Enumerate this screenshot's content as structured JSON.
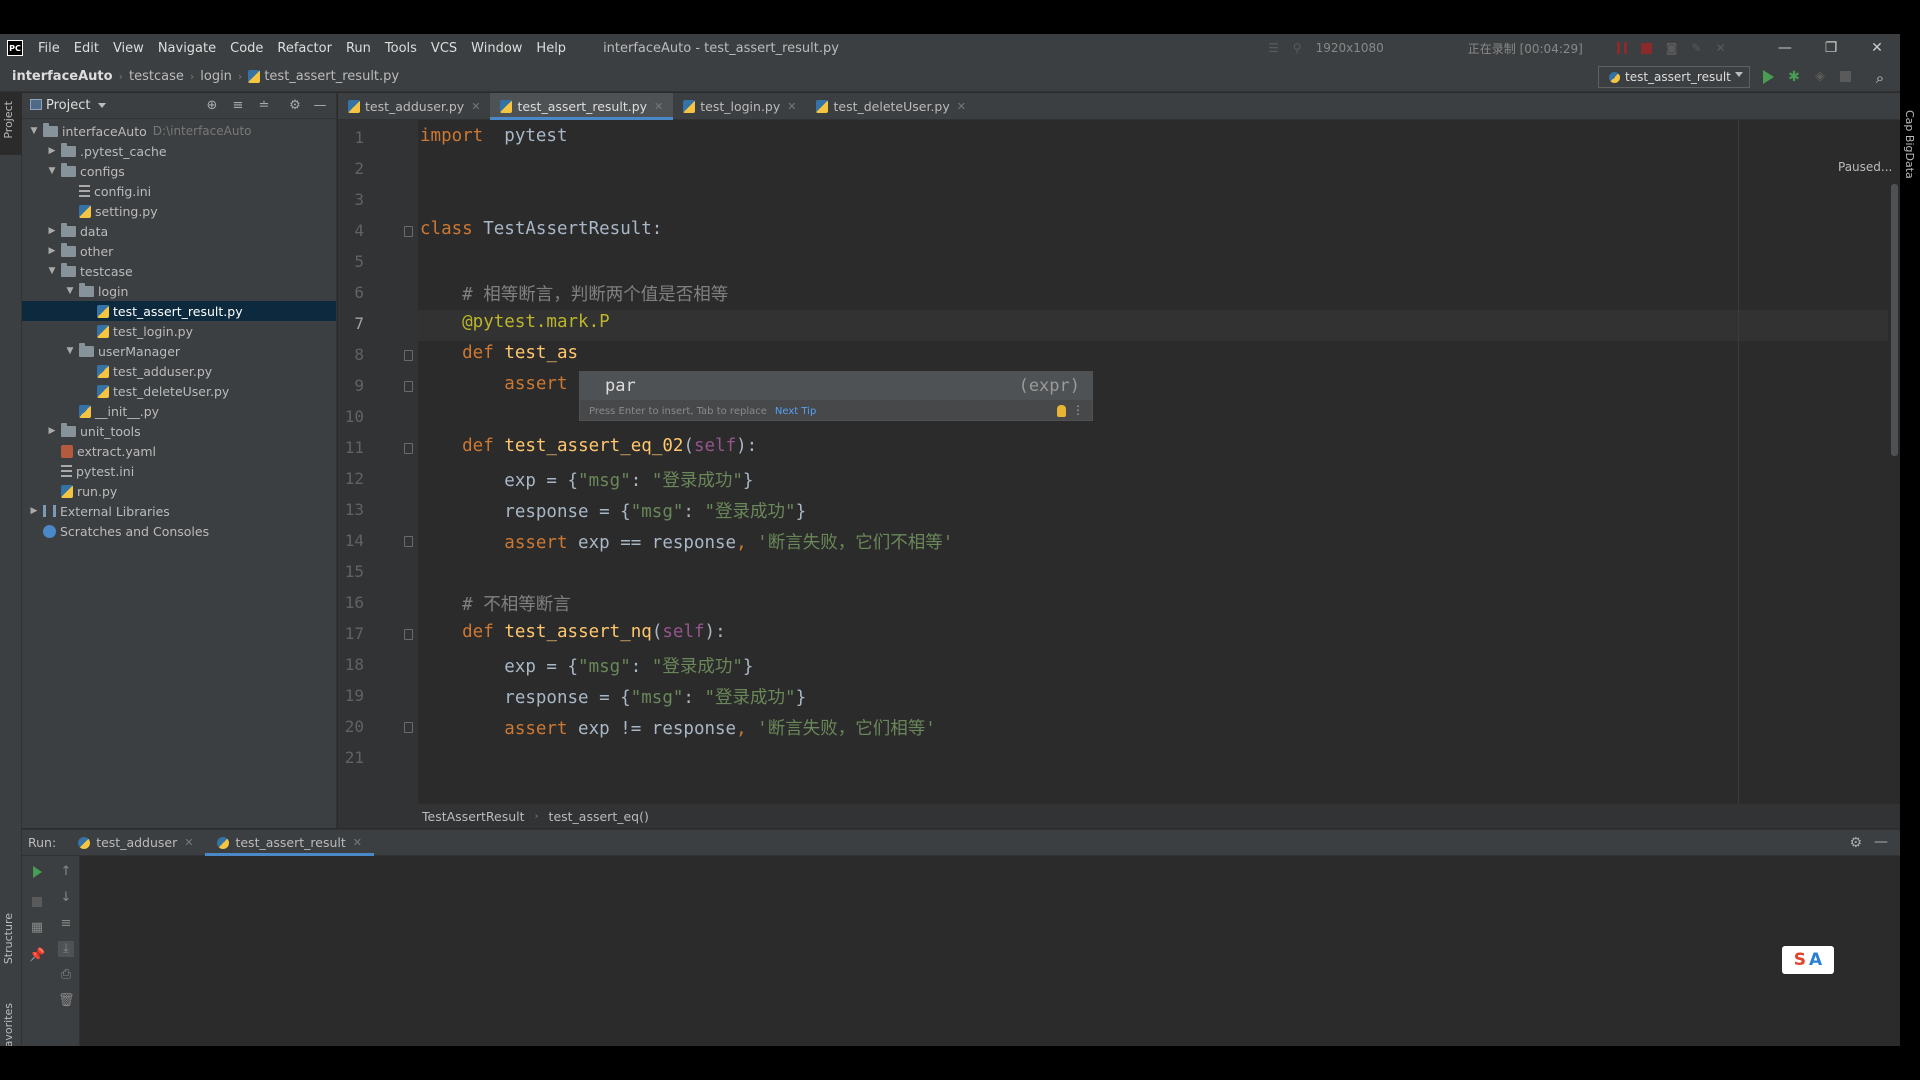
{
  "menubar": {
    "items": [
      "File",
      "Edit",
      "View",
      "Navigate",
      "Code",
      "Refactor",
      "Run",
      "Tools",
      "VCS",
      "Window",
      "Help"
    ],
    "window_title": "interfaceAuto - test_assert_result.py",
    "recorder_resolution": "1920x1080",
    "recorder_status": "正在录制 [00:04:29]"
  },
  "navbar": {
    "crumbs": [
      "interfaceAuto",
      "testcase",
      "login",
      "test_assert_result.py"
    ],
    "run_config": "test_assert_result"
  },
  "left_strip": {
    "project_tab": "Project",
    "structure_tab": "Structure",
    "favorites_tab": "Favorites"
  },
  "project": {
    "title": "Project",
    "tree": [
      {
        "label": "interfaceAuto",
        "hint": "D:\\interfaceAuto",
        "depth": 0,
        "arrow": "v",
        "icon": "folder"
      },
      {
        "label": ".pytest_cache",
        "depth": 1,
        "arrow": ">",
        "icon": "folder"
      },
      {
        "label": "configs",
        "depth": 1,
        "arrow": "v",
        "icon": "folder"
      },
      {
        "label": "config.ini",
        "depth": 2,
        "arrow": "",
        "icon": "ini"
      },
      {
        "label": "setting.py",
        "depth": 2,
        "arrow": "",
        "icon": "py"
      },
      {
        "label": "data",
        "depth": 1,
        "arrow": ">",
        "icon": "folder"
      },
      {
        "label": "other",
        "depth": 1,
        "arrow": ">",
        "icon": "folder"
      },
      {
        "label": "testcase",
        "depth": 1,
        "arrow": "v",
        "icon": "folder"
      },
      {
        "label": "login",
        "depth": 2,
        "arrow": "v",
        "icon": "folder"
      },
      {
        "label": "test_assert_result.py",
        "depth": 3,
        "arrow": "",
        "icon": "py",
        "selected": true
      },
      {
        "label": "test_login.py",
        "depth": 3,
        "arrow": "",
        "icon": "py"
      },
      {
        "label": "userManager",
        "depth": 2,
        "arrow": "v",
        "icon": "folder"
      },
      {
        "label": "test_adduser.py",
        "depth": 3,
        "arrow": "",
        "icon": "py"
      },
      {
        "label": "test_deleteUser.py",
        "depth": 3,
        "arrow": "",
        "icon": "py"
      },
      {
        "label": "__init__.py",
        "depth": 2,
        "arrow": "",
        "icon": "py"
      },
      {
        "label": "unit_tools",
        "depth": 1,
        "arrow": ">",
        "icon": "folder"
      },
      {
        "label": "extract.yaml",
        "depth": 1,
        "arrow": "",
        "icon": "yaml"
      },
      {
        "label": "pytest.ini",
        "depth": 1,
        "arrow": "",
        "icon": "ini"
      },
      {
        "label": "run.py",
        "depth": 1,
        "arrow": "",
        "icon": "py"
      },
      {
        "label": "External Libraries",
        "depth": 0,
        "arrow": ">",
        "icon": "lib"
      },
      {
        "label": "Scratches and Consoles",
        "depth": 0,
        "arrow": "",
        "icon": "scratch"
      }
    ]
  },
  "editor": {
    "tabs": [
      {
        "label": "test_adduser.py",
        "active": false
      },
      {
        "label": "test_assert_result.py",
        "active": true
      },
      {
        "label": "test_login.py",
        "active": false
      },
      {
        "label": "test_deleteUser.py",
        "active": false
      }
    ],
    "current_line": 7,
    "line_numbers": [
      "1",
      "2",
      "3",
      "4",
      "5",
      "6",
      "7",
      "8",
      "9",
      "10",
      "11",
      "12",
      "13",
      "14",
      "15",
      "16",
      "17",
      "18",
      "19",
      "20",
      "21"
    ],
    "lines": [
      [
        [
          "kw",
          "import"
        ],
        [
          "",
          "  pytest"
        ]
      ],
      [],
      [],
      [
        [
          "kw",
          "class"
        ],
        [
          "",
          " TestAssertResult:"
        ]
      ],
      [],
      [
        [
          "cmt",
          "    # 相等断言，判断两个值是否相等"
        ]
      ],
      [
        [
          "deco",
          "    @pytest.mark.P"
        ]
      ],
      [
        [
          "kw",
          "    def"
        ],
        [
          "",
          " "
        ],
        [
          "fn",
          "test_as"
        ]
      ],
      [
        [
          "kw",
          "        assert"
        ]
      ],
      [],
      [
        [
          "kw",
          "    def"
        ],
        [
          "",
          " "
        ],
        [
          "fn",
          "test_assert_eq_02"
        ],
        [
          "",
          "("
        ],
        [
          "self",
          "self"
        ],
        [
          "",
          "):"
        ]
      ],
      [
        [
          "",
          "        exp = {"
        ],
        [
          "str",
          "\"msg\""
        ],
        [
          "",
          ": "
        ],
        [
          "str",
          "\"登录成功\""
        ],
        [
          "",
          "}"
        ]
      ],
      [
        [
          "",
          "        response = {"
        ],
        [
          "str",
          "\"msg\""
        ],
        [
          "",
          ": "
        ],
        [
          "str",
          "\"登录成功\""
        ],
        [
          "",
          "}"
        ]
      ],
      [
        [
          "kw",
          "        assert"
        ],
        [
          "",
          " exp == response"
        ],
        [
          "kw",
          ", "
        ],
        [
          "str",
          "'断言失败，它们不相等'"
        ]
      ],
      [],
      [
        [
          "cmt",
          "    # 不相等断言"
        ]
      ],
      [
        [
          "kw",
          "    def"
        ],
        [
          "",
          " "
        ],
        [
          "fn",
          "test_assert_nq"
        ],
        [
          "",
          "("
        ],
        [
          "self",
          "self"
        ],
        [
          "",
          "):"
        ]
      ],
      [
        [
          "",
          "        exp = {"
        ],
        [
          "str",
          "\"msg\""
        ],
        [
          "",
          ": "
        ],
        [
          "str",
          "\"登录成功\""
        ],
        [
          "",
          "}"
        ]
      ],
      [
        [
          "",
          "        response = {"
        ],
        [
          "str",
          "\"msg\""
        ],
        [
          "",
          ": "
        ],
        [
          "str",
          "\"登录成功\""
        ],
        [
          "",
          "}"
        ]
      ],
      [
        [
          "kw",
          "        assert"
        ],
        [
          "",
          " exp != response"
        ],
        [
          "kw",
          ", "
        ],
        [
          "str",
          "'断言失败，它们相等'"
        ]
      ],
      []
    ],
    "paused_label": "Paused...",
    "completion": {
      "item": "par",
      "type_hint": "(expr)",
      "footer": "Press Enter to insert, Tab to replace",
      "next_tip": "Next Tip"
    },
    "crumbs": [
      "TestAssertResult",
      "test_assert_eq()"
    ]
  },
  "run_panel": {
    "label": "Run:",
    "tabs": [
      {
        "label": "test_adduser",
        "active": false
      },
      {
        "label": "test_assert_result",
        "active": true
      }
    ]
  },
  "right_strip": {
    "label": "Cap BigData"
  },
  "colors": {
    "accent": "#4a88c7",
    "selection": "#0d293e",
    "run_green": "#499c54"
  }
}
